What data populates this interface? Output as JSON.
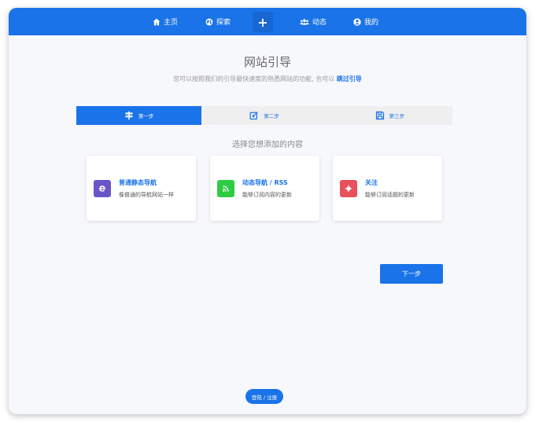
{
  "nav": {
    "home": "主页",
    "explore": "探索",
    "add": "+",
    "activity": "动态",
    "mine": "我的"
  },
  "header": {
    "title": "网站引导",
    "subtitle": "您可以按照我们的引导最快速度的熟悉网站的功能, 也可以",
    "skip_label": "跳过引导"
  },
  "steps": [
    {
      "label": "第一步",
      "icon": "signpost-icon",
      "active": true
    },
    {
      "label": "第二步",
      "icon": "edit-icon",
      "active": false
    },
    {
      "label": "第三步",
      "icon": "save-icon",
      "active": false
    }
  ],
  "section_heading": "选择您想添加的内容",
  "cards": [
    {
      "title": "普通静态导航",
      "desc": "像普通的导航网站一样",
      "icon": "ie-icon",
      "icon_color": "#6a55c8"
    },
    {
      "title": "动态导航 / RSS",
      "desc": "能够订阅内容的更新",
      "icon": "rss-icon",
      "icon_color": "#2ecc40"
    },
    {
      "title": "关注",
      "desc": "能够订阅话题的更新",
      "icon": "target-icon",
      "icon_color": "#e8505b"
    }
  ],
  "next_label": "下一步",
  "login_label": "登陆 / 注册",
  "colors": {
    "accent": "#1a73e8",
    "background": "#f7f8fc"
  }
}
